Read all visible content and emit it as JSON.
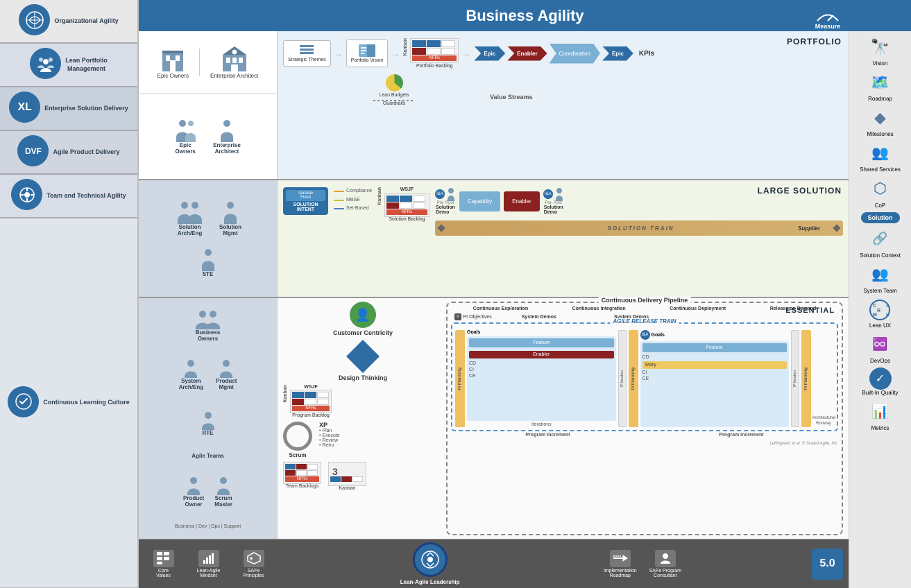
{
  "header": {
    "title": "Business Agility",
    "measure_grow": "Measure\n& Grow"
  },
  "left_sidebar": {
    "items": [
      {
        "label": "Organizational\nAgility",
        "icon": "🌐"
      },
      {
        "label": "Lean Portfolio\nManagement",
        "icon": "📊"
      },
      {
        "label": "Enterprise Solution\nDelivery",
        "icon": "📦"
      },
      {
        "label": "Agile Product\nDelivery",
        "icon": "⚙️"
      },
      {
        "label": "Team and\nTechnical Agility",
        "icon": "🔧"
      },
      {
        "label": "Continuous\nLearning Culture",
        "icon": "📚"
      }
    ]
  },
  "portfolio_section": {
    "zone_label": "PORTFOLIO",
    "people": [
      {
        "label": "Epic\nOwners"
      },
      {
        "label": "Enterprise\nArchitect"
      }
    ],
    "flow_items": [
      {
        "label": "Strategic\nThemes"
      },
      {
        "label": "Portfolio\nVision"
      }
    ],
    "kanban_label": "Kanban",
    "portfolio_backlog": "Portfolio Backlog",
    "lean_budgets": "Lean Budgets",
    "guardrails": "Guardrails",
    "epic_label": "Epic",
    "enabler_label": "Enabler",
    "coordination_label": "Coordination",
    "kpis_label": "KPIs",
    "value_streams_label": "Value Streams"
  },
  "large_solution_section": {
    "zone_label": "LARGE SOLUTION",
    "people": [
      {
        "label": "Solution\nArch/Eng"
      },
      {
        "label": "Solution\nMgmt"
      },
      {
        "label": "STE"
      }
    ],
    "solution_intent": "SOLUTION INTENT",
    "variable_fixed": "Variable\nFixed",
    "compliance": "Compliance",
    "mbse": "MBSE",
    "set_based": "Set-Based",
    "kanban_label": "Kanban",
    "wsjf_label": "WSJF",
    "nfr_label": "NFRs",
    "solution_backlog": "Solution Backlog",
    "solution_demo_label": "Solution\nDemo",
    "capability_label": "Capability",
    "enabler_label": "Enabler",
    "solution_train": "SOLUTION TRAIN",
    "supplier_label": "Supplier"
  },
  "agile_section": {
    "zone_label": "ESSENTIAL",
    "people": [
      {
        "label": "Business\nOwners"
      },
      {
        "label": "System\nArch/Eng"
      },
      {
        "label": "Product\nMgmt"
      },
      {
        "label": "RTE"
      },
      {
        "label": "Agile Teams"
      },
      {
        "label": "Product\nOwner"
      },
      {
        "label": "Scrum\nMaster"
      }
    ],
    "business_dev_ops": "Business | Dev | Ops | Support",
    "customer_centricity": "Customer Centricity",
    "design_thinking": "Design Thinking",
    "kanban_label": "Kanban",
    "wsjf_label": "WSJF",
    "nfr_label": "NFRs",
    "program_backlog": "Program\nBacklog",
    "scrum_label": "Scrum",
    "xp_label": "XP",
    "xp_items": [
      "• Plan",
      "• Execute",
      "• Review",
      "• Retro"
    ],
    "team_backlogs": "Team\nBacklogs",
    "kanban_board": "Kanban",
    "cdp_label": "Continuous Delivery Pipeline",
    "art_label": "AGILE RELEASE TRAIN",
    "continuous_exploration": "Continuous\nExploration",
    "continuous_integration": "Continuous\nIntegration",
    "continuous_deployment": "Continuous\nDeployment",
    "release_on_demand": "Release\non Demand",
    "pi_objectives": "PI Objectives",
    "system_demos": "System Demos",
    "program_increment": "Program Increment",
    "arch_runway": "Architectural\nRunway",
    "copyright": "Leffingwell, et al. © Scaled Agile, Inc."
  },
  "right_sidebar": {
    "items": [
      {
        "label": "Vision",
        "icon": "🔭"
      },
      {
        "label": "Roadmap",
        "icon": "🗺️"
      },
      {
        "label": "Milestones",
        "icon": "◆"
      },
      {
        "label": "Shared\nServices",
        "icon": "👥"
      },
      {
        "label": "CoP",
        "icon": "⬡"
      },
      {
        "label": "Solution\nContext",
        "icon": "🔗"
      },
      {
        "label": "System\nTeam",
        "icon": "👥"
      },
      {
        "label": "Lean UX",
        "icon": "🔄"
      },
      {
        "label": "DevOps",
        "icon": "♾️"
      },
      {
        "label": "Metrics",
        "icon": "📊"
      },
      {
        "label": "Built-In\nQuality",
        "icon": "✅"
      }
    ],
    "solution_label": "Solution"
  },
  "footer": {
    "items": [
      {
        "label": "Core\nValues",
        "icon": "📋"
      },
      {
        "label": "Lean-Agile\nMindset",
        "icon": "🏛️"
      },
      {
        "label": "SAFe\nPrinciples",
        "icon": "🏛️"
      },
      {
        "label": "Implementation\nRoadmap",
        "icon": "➡️"
      },
      {
        "label": "SAFe Program\nConsultant",
        "icon": "👤"
      }
    ],
    "center_label": "Lean-Agile Leadership",
    "version": "5.0"
  }
}
